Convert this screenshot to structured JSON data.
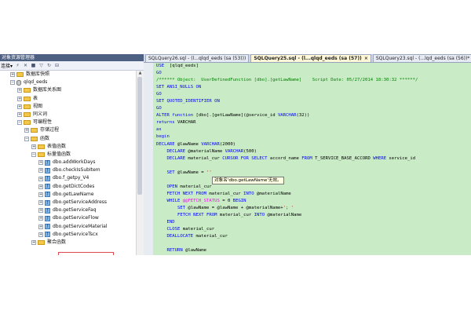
{
  "explorer": {
    "title": "对象资源管理器",
    "connect_label": "连接▾",
    "tree": [
      {
        "label": "数据库快照",
        "kind": "folder",
        "indent": 1,
        "exp": "+"
      },
      {
        "label": "qlqd_eeds",
        "kind": "db",
        "indent": 1,
        "exp": "-"
      },
      {
        "label": "数据库关系图",
        "kind": "folder",
        "indent": 2,
        "exp": "+"
      },
      {
        "label": "表",
        "kind": "folder",
        "indent": 2,
        "exp": "+"
      },
      {
        "label": "视图",
        "kind": "folder",
        "indent": 2,
        "exp": "+"
      },
      {
        "label": "同义词",
        "kind": "folder",
        "indent": 2,
        "exp": "+"
      },
      {
        "label": "可编程性",
        "kind": "folder",
        "indent": 2,
        "exp": "-"
      },
      {
        "label": "存储过程",
        "kind": "folder",
        "indent": 3,
        "exp": "+"
      },
      {
        "label": "函数",
        "kind": "folder",
        "indent": 3,
        "exp": "-"
      },
      {
        "label": "表值函数",
        "kind": "folder",
        "indent": 4,
        "exp": "+"
      },
      {
        "label": "标量值函数",
        "kind": "folder",
        "indent": 4,
        "exp": "-"
      },
      {
        "label": "dbo.addWorkDays",
        "kind": "fn",
        "indent": 5,
        "exp": "+"
      },
      {
        "label": "dbo.checkIsSubItem",
        "kind": "fn",
        "indent": 5,
        "exp": "+"
      },
      {
        "label": "dbo.f_getpy_V4",
        "kind": "fn",
        "indent": 5,
        "exp": "+"
      },
      {
        "label": "dbo.getDictCodes",
        "kind": "fn",
        "indent": 5,
        "exp": "+"
      },
      {
        "label": "dbo.getLawName",
        "kind": "fn",
        "indent": 5,
        "exp": "+"
      },
      {
        "label": "dbo.getServiceAddress",
        "kind": "fn",
        "indent": 5,
        "exp": "+"
      },
      {
        "label": "dbo.getServiceFaq",
        "kind": "fn",
        "indent": 5,
        "exp": "+"
      },
      {
        "label": "dbo.getServiceFlow",
        "kind": "fn",
        "indent": 5,
        "exp": "+"
      },
      {
        "label": "dbo.getServiceMaterial",
        "kind": "fn",
        "indent": 5,
        "exp": "+"
      },
      {
        "label": "dbo.getServiceTscx",
        "kind": "fn",
        "indent": 5,
        "exp": "+"
      },
      {
        "label": "聚合函数",
        "kind": "folder",
        "indent": 4,
        "exp": "+"
      }
    ]
  },
  "tabs": [
    {
      "label": "SQLQuery26.sql - (l...qlqd_eeds (sa (53)))",
      "active": false
    },
    {
      "label": "SQLQuery25.sql - (l...qlqd_eeds (sa (57))",
      "active": true
    },
    {
      "label": "SQLQuery23.sql - (...lqd_eeds (sa (56))*",
      "active": false
    }
  ],
  "tab_close": "×",
  "code_lines": [
    [
      [
        "kw",
        "USE"
      ],
      [
        "",
        "  [qlqd_eeds]"
      ]
    ],
    [
      [
        "kw",
        "GO"
      ]
    ],
    [
      [
        "cm",
        "/****** Object:  UserDefinedFunction [dbo].[getLawName]    Script Date: 05/27/2014 18:30:32 ******/"
      ]
    ],
    [
      [
        "kw",
        "SET ANSI_NULLS ON"
      ]
    ],
    [
      [
        "kw",
        "GO"
      ]
    ],
    [
      [
        "kw",
        "SET QUOTED_IDENTIFIER ON"
      ]
    ],
    [
      [
        "kw",
        "GO"
      ]
    ],
    [
      [
        "kw",
        "ALTER function"
      ],
      [
        "",
        " [dbo].[getLawName](@service_id "
      ],
      [
        "kw",
        "VARCHAR"
      ],
      [
        "",
        "(32))"
      ]
    ],
    [
      [
        "kw",
        "returns"
      ],
      [
        "",
        " VARCHAR"
      ]
    ],
    [
      [
        "kw",
        "as"
      ]
    ],
    [
      [
        "kw",
        "begin"
      ]
    ],
    [
      [
        "kw",
        "DECLARE"
      ],
      [
        "",
        " @lawName "
      ],
      [
        "kw",
        "VARCHAR"
      ],
      [
        "",
        "(2000)"
      ]
    ],
    [
      [
        "",
        "    "
      ],
      [
        "kw",
        "DECLARE"
      ],
      [
        "",
        " @materialName "
      ],
      [
        "kw",
        "VARCHAR"
      ],
      [
        "",
        "(500)"
      ]
    ],
    [
      [
        "",
        "    "
      ],
      [
        "kw",
        "DECLARE"
      ],
      [
        "",
        " material_cur "
      ],
      [
        "kw",
        "CURSOR FOR SELECT"
      ],
      [
        "",
        " accord_name "
      ],
      [
        "kw",
        "FROM"
      ],
      [
        "",
        " T_SERVICE_BASE_ACCORD "
      ],
      [
        "kw",
        "WHERE"
      ],
      [
        "",
        " service_id"
      ]
    ],
    [
      [
        "",
        "    "
      ]
    ],
    [
      [
        "",
        "    "
      ],
      [
        "kw",
        "SET"
      ],
      [
        "",
        " @lawName = "
      ],
      [
        "st",
        "''"
      ]
    ],
    [
      [
        "",
        "    "
      ]
    ],
    [
      [
        "",
        "    "
      ],
      [
        "kw",
        "OPEN"
      ],
      [
        "",
        " material_cur"
      ]
    ],
    [
      [
        "",
        "    "
      ],
      [
        "kw",
        "FETCH NEXT FROM"
      ],
      [
        "",
        " material_cur "
      ],
      [
        "kw",
        "INTO"
      ],
      [
        "",
        " @materialName"
      ]
    ],
    [
      [
        "",
        "    "
      ],
      [
        "kw",
        "WHILE"
      ],
      [
        "",
        " "
      ],
      [
        "fnm",
        "@@FETCH_STATUS"
      ],
      [
        "",
        " = 0 "
      ],
      [
        "kw",
        "BEGIN"
      ]
    ],
    [
      [
        "",
        "        "
      ],
      [
        "kw",
        "SET"
      ],
      [
        "",
        " @lawName = @lawName + @materialName+"
      ],
      [
        "st",
        "'; '"
      ]
    ],
    [
      [
        "",
        "        "
      ],
      [
        "kw",
        "FETCH NEXT FROM"
      ],
      [
        "",
        " material_cur "
      ],
      [
        "kw",
        "INTO"
      ],
      [
        "",
        " @materialName"
      ]
    ],
    [
      [
        "",
        "    "
      ],
      [
        "kw",
        "END"
      ]
    ],
    [
      [
        "",
        "    "
      ],
      [
        "kw",
        "CLOSE"
      ],
      [
        "",
        " material_cur"
      ]
    ],
    [
      [
        "",
        "    "
      ],
      [
        "kw",
        "DEALLOCATE"
      ],
      [
        "",
        " material_cur"
      ]
    ],
    [
      [
        "",
        "    "
      ]
    ],
    [
      [
        "",
        "    "
      ],
      [
        "kw",
        "RETURN"
      ],
      [
        "",
        " @lawName"
      ]
    ]
  ],
  "tooltip": "对象名'dbo.getLawName'无效。"
}
